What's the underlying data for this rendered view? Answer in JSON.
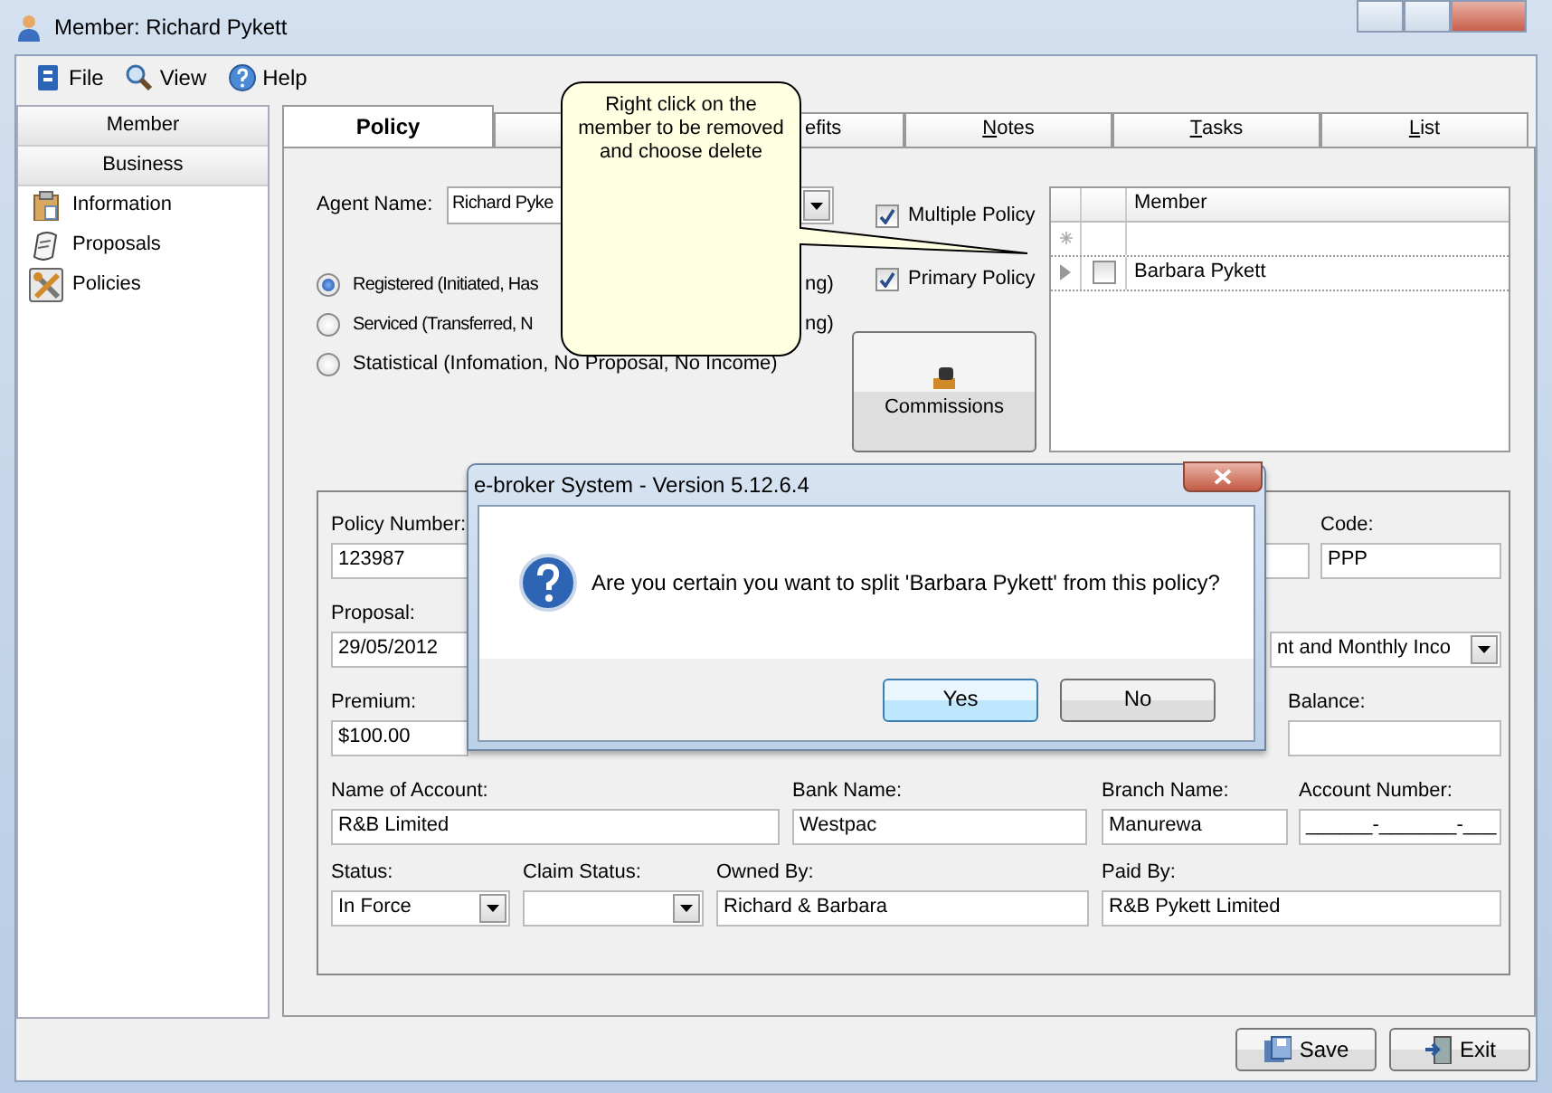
{
  "window": {
    "title": "Member: Richard Pykett"
  },
  "menu": [
    {
      "label": "File"
    },
    {
      "label": "View"
    },
    {
      "label": "Help"
    }
  ],
  "sidebar": {
    "headers": [
      "Member",
      "Business"
    ],
    "items": [
      {
        "label": "Information",
        "selected": false
      },
      {
        "label": "Proposals",
        "selected": false
      },
      {
        "label": "Policies",
        "selected": true
      }
    ]
  },
  "tabs": [
    {
      "label": "Policy",
      "selected": true,
      "underline_first": false
    },
    {
      "selected": false
    },
    {
      "label": "efits",
      "selected": false,
      "clipped_left": true,
      "underline_first": false
    },
    {
      "label": "Notes",
      "selected": false,
      "underline_first": true
    },
    {
      "label": "Tasks",
      "selected": false,
      "underline_first": true
    },
    {
      "label": "List",
      "selected": false,
      "underline_first": true
    }
  ],
  "agent": {
    "label": "Agent Name:",
    "value": "Richard Pyke"
  },
  "radios": [
    {
      "label": "Registered (Initiated, Has",
      "tail": "ng)",
      "selected": true
    },
    {
      "label": "Serviced (Transferred, N",
      "tail": "ng)",
      "selected": false
    },
    {
      "label": "Statistical (Infomation, No Proposal, No Income)",
      "selected": false
    }
  ],
  "checkboxes": [
    {
      "label": "Multiple Policy",
      "checked": true
    },
    {
      "label": "Primary Policy",
      "checked": true
    }
  ],
  "commissions_button": "Commissions",
  "member_grid": {
    "column": "Member",
    "rows": [
      {
        "member": "Barbara Pykett",
        "checked": false,
        "current": true
      }
    ]
  },
  "callout": "Right click on the member to be removed and choose delete",
  "form": {
    "rows": [
      {
        "left": [
          {
            "label": "Policy Number:",
            "value": "123987",
            "kind": "text"
          }
        ],
        "right": [
          {
            "kind": "text"
          },
          {
            "label": "Code:",
            "value": "PPP",
            "kind": "text"
          }
        ]
      },
      {
        "left": [
          {
            "label": "Proposal:",
            "value": "29/05/2012",
            "kind": "text"
          }
        ],
        "right": [
          {
            "value": "nt and Monthly Inco",
            "kind": "dropdown"
          }
        ]
      },
      {
        "left": [
          {
            "label": "Premium:",
            "value": "$100.00",
            "kind": "text"
          }
        ],
        "right": [
          {
            "label": "Balance:",
            "kind": "text"
          }
        ]
      },
      {
        "left": [
          {
            "label": "Name of Account:",
            "value": "R&B Limited",
            "kind": "text"
          },
          {
            "label": "Bank Name:",
            "value": "Westpac",
            "kind": "text"
          },
          {
            "label": "Branch Name:",
            "value": "Manurewa",
            "kind": "text"
          },
          {
            "label": "Account Number:",
            "value": "______-_______-___",
            "kind": "text"
          }
        ]
      },
      {
        "left": [
          {
            "label": "Status:",
            "value": "In Force",
            "kind": "dropdown"
          },
          {
            "label": "Claim Status:",
            "kind": "dropdown"
          },
          {
            "label": "Owned By:",
            "value": "Richard & Barbara",
            "kind": "text"
          },
          {
            "label": "Paid By:",
            "value": "R&B Pykett Limited",
            "kind": "text"
          }
        ]
      }
    ]
  },
  "dialog": {
    "title": "e-broker System - Version 5.12.6.4",
    "message": "Are you certain you want to split 'Barbara Pykett' from this policy?",
    "buttons": [
      {
        "label": "Yes",
        "default": true
      },
      {
        "label": "No",
        "default": false
      }
    ]
  },
  "footer_buttons": [
    {
      "label": "Save"
    },
    {
      "label": "Exit"
    }
  ]
}
